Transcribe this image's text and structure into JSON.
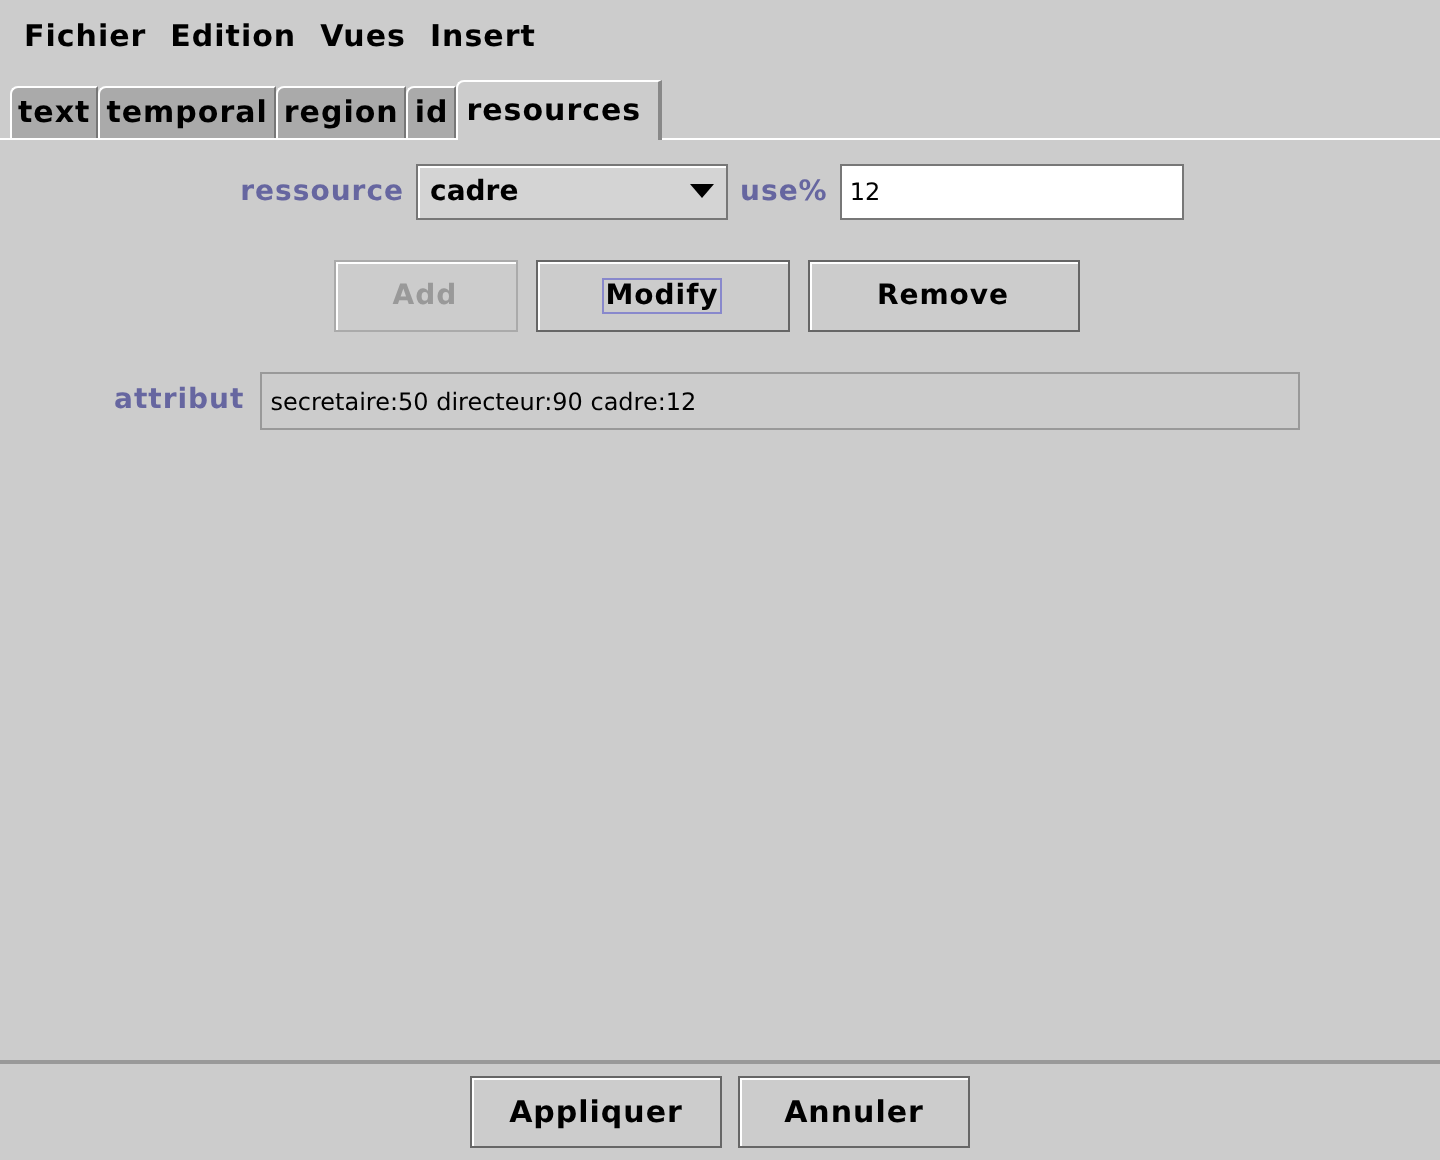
{
  "menu": [
    "Fichier",
    "Edition",
    "Vues",
    "Insert"
  ],
  "tabs": [
    {
      "label": "text",
      "selected": false
    },
    {
      "label": "temporal",
      "selected": false
    },
    {
      "label": "region",
      "selected": false
    },
    {
      "label": "id",
      "selected": false
    },
    {
      "label": "resources",
      "selected": true
    }
  ],
  "ressource": {
    "label": "ressource",
    "value": "cadre"
  },
  "use": {
    "label": "use%",
    "value": "12"
  },
  "actions": [
    {
      "label": "Add",
      "disabled": true,
      "focused": false
    },
    {
      "label": "Modify",
      "disabled": false,
      "focused": true
    },
    {
      "label": "Remove",
      "disabled": false,
      "focused": false
    }
  ],
  "attribut": {
    "label": "attribut",
    "value": "secretaire:50 directeur:90 cadre:12"
  },
  "footer_buttons": [
    "Appliquer",
    "Annuler"
  ]
}
